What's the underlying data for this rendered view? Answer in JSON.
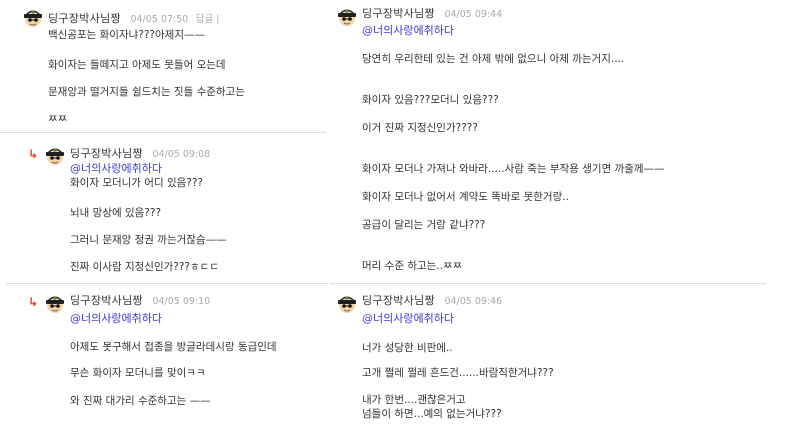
{
  "avatar_colors": {
    "helmet": "#1f1f1f",
    "skin": "#f2d4a6",
    "emblem": "#6a7a3a"
  },
  "accent": {
    "mention": "#3b3bd6",
    "reply_arrow": "#e04a26",
    "timestamp": "#aaaaaa"
  },
  "comments": [
    {
      "nickname": "딩구장박사님짱",
      "time": "04/05 07:50",
      "reply_label": "답글 |",
      "lines": [
        "백신공포는 화이자냐???아제지——",
        "화이자는 들떼지고 아제도 못들어 오는데",
        "문재앙과 떨거지들 쉴드치는 짓들 수준하고는",
        "ㅉㅉ"
      ]
    },
    {
      "nickname": "딩구장박사님짱",
      "time": "04/05 09:08",
      "mention": "@너의사랑에취하다",
      "lines": [
        "화이자 모더니가 어디 있음???",
        "뇌내 망상에 있음???",
        "그러니 문재앙 정권 까는거잖슴——",
        "진짜 이사람 지정신인가???ㅎㄷㄷ"
      ]
    },
    {
      "nickname": "딩구장박사님짱",
      "time": "04/05 09:10",
      "mention": "@너의사랑에취하다",
      "lines": [
        "아제도 못구해서 접종을 방글라데시랑 동급인데",
        "무슨 화이자 모더니를 맞이ㅋㅋ",
        "와 진짜 대가리 수준하고는 ——"
      ]
    },
    {
      "nickname": "딩구장박사님짱",
      "time": "04/05 09:44",
      "mention": "@너의사랑에취하다",
      "lines": [
        "당연히 우리한테 있는 건 아제 밖에 없으니 아제 까는거지....",
        "화이자 있음???모더니 있음???",
        "이거 진짜 지정신인가????",
        "화이자 모더나 가져나 와바라.....사람 죽는 부작용 생기면 까줄께——",
        "화이자 모더나 없어서 계약도 똑바로 못한거랑..",
        "공급이 달리는 거랑 같냐???",
        "머리 수준 하고는..ㅉㅉ"
      ]
    },
    {
      "nickname": "딩구장박사님짱",
      "time": "04/05 09:46",
      "mention": "@너의사랑에취하다",
      "lines": [
        "너가 성당한 비판에..",
        "고개 쩔레 쩔레 흔드건......바람직한거냐???",
        "내가 한번....괜찮은거고",
        "넘들이 하면...예의 없는거냐???"
      ]
    }
  ]
}
